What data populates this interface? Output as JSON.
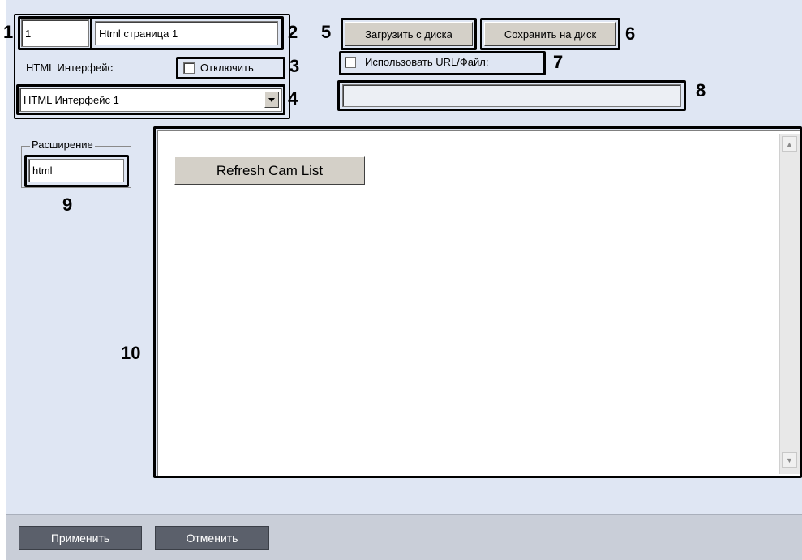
{
  "top_left": {
    "id_value": "1",
    "name_value": "Html страница 1",
    "interface_label": "HTML Интерфейс",
    "disable_label": "Отключить",
    "interface_select_value": "HTML Интерфейс 1"
  },
  "top_right": {
    "load_button": "Загрузить с диска",
    "save_button": "Сохранить на диск",
    "use_url_label": "Использовать URL/Файл:",
    "url_value": ""
  },
  "extension": {
    "legend": "Расширение",
    "value": "html"
  },
  "preview": {
    "refresh_button": "Refresh Cam List"
  },
  "callouts": {
    "c1": "1",
    "c2": "2",
    "c3": "3",
    "c4": "4",
    "c5": "5",
    "c6": "6",
    "c7": "7",
    "c8": "8",
    "c9": "9",
    "c10": "10"
  },
  "footer": {
    "apply_button": "Применить",
    "cancel_button": "Отменить"
  },
  "colors": {
    "panel_bg": "#dfe6f3",
    "button_face": "#d4d0c8",
    "footer_bg": "#c9ced8",
    "footer_button": "#5b606b"
  },
  "icons": {
    "dropdown": "chevron-down-icon",
    "scroll_up": "arrow-up-icon",
    "scroll_down": "arrow-down-icon"
  }
}
